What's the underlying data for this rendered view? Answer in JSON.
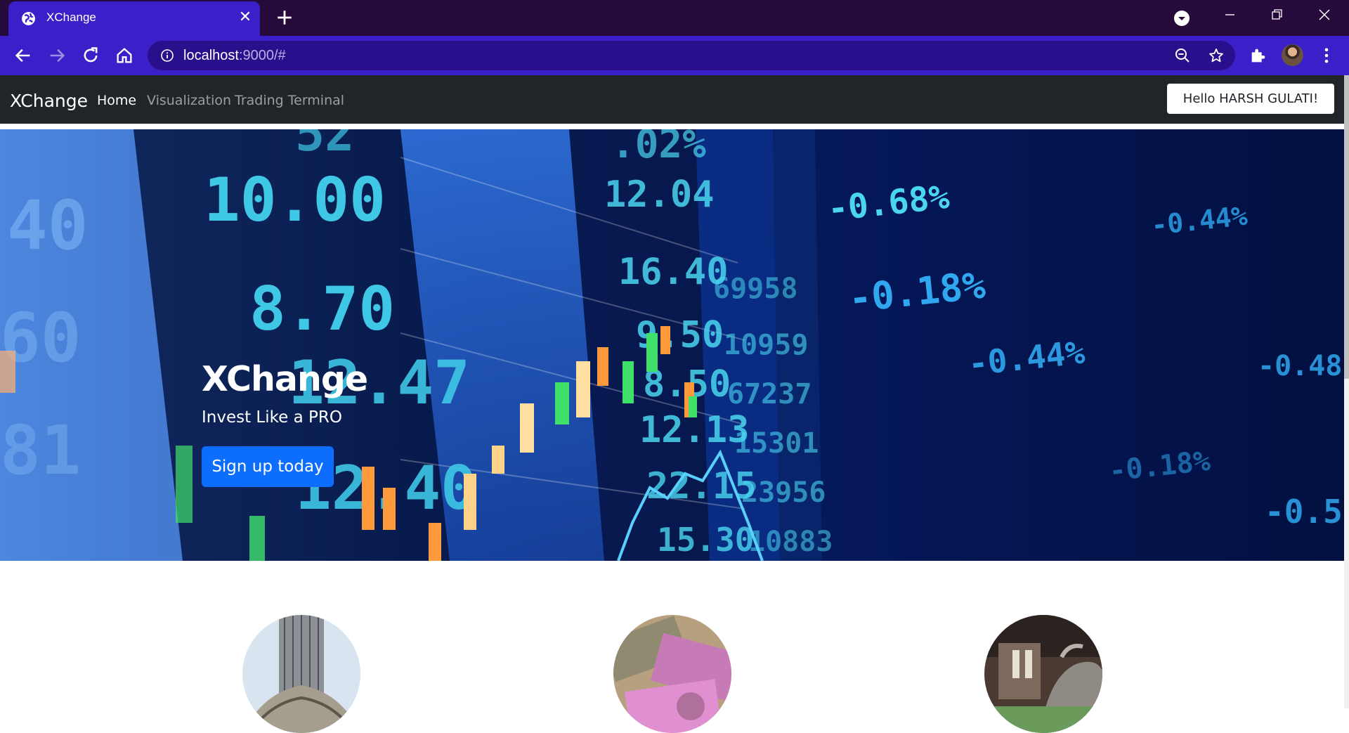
{
  "browser": {
    "tab_title": "XChange",
    "url_host": "localhost",
    "url_rest": ":9000/#"
  },
  "navbar": {
    "brand": "XChange",
    "links": [
      {
        "label": "Home",
        "active": true
      },
      {
        "label": "Visualization",
        "active": false
      },
      {
        "label": "Trading Terminal",
        "active": false
      }
    ],
    "greeting": "Hello HARSH GULATI!"
  },
  "hero": {
    "title": "XChange",
    "subtitle": "Invest Like a PRO",
    "cta": "Sign up today",
    "ticker_values": [
      "10.00",
      "8.70",
      "12.47",
      "81",
      "12.40",
      "12.04",
      "16.40",
      "9.50",
      "8.50",
      "12.13",
      "22.15",
      "15.30",
      "69958",
      "10959",
      "67237",
      "15301",
      "23956",
      "10883",
      "-0.68%",
      "-0.18%",
      "-0.44%",
      "-0.44%",
      "-0.48",
      "-0.18%",
      "-0.5"
    ]
  },
  "colors": {
    "accent": "#0d6efd",
    "navbar_bg": "#212529",
    "browser_frame": "#3b20c9",
    "tabbar": "#250a3b"
  }
}
